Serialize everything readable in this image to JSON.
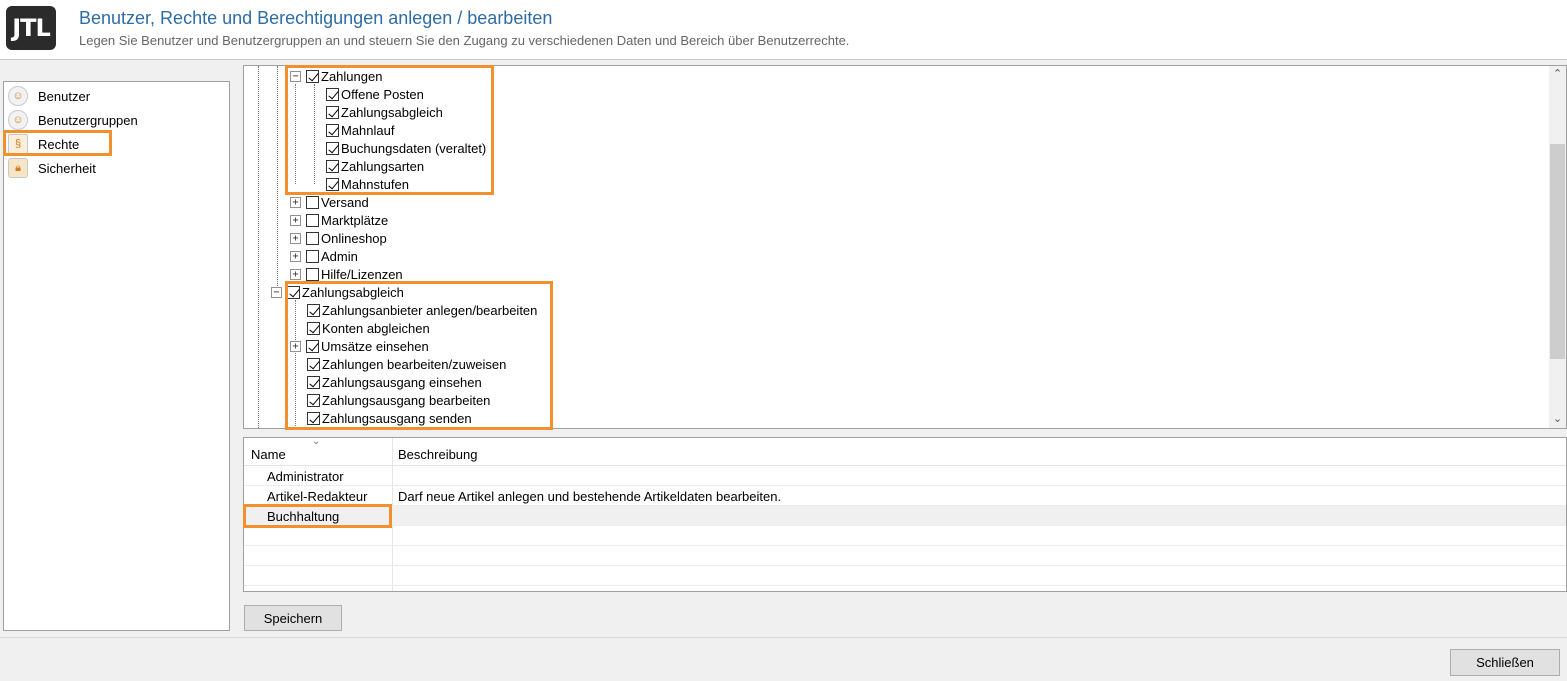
{
  "header": {
    "logo": "JTL",
    "title": "Benutzer, Rechte und Berechtigungen anlegen / bearbeiten",
    "subtitle": "Legen Sie Benutzer und Benutzergruppen an und steuern Sie den Zugang zu verschiedenen Daten und Bereich über Benutzerrechte."
  },
  "nav": {
    "items": [
      {
        "label": "Benutzer",
        "icon": "user-icon"
      },
      {
        "label": "Benutzergruppen",
        "icon": "user-group-icon"
      },
      {
        "label": "Rechte",
        "icon": "rights-icon",
        "highlighted": true
      },
      {
        "label": "Sicherheit",
        "icon": "lock-icon"
      }
    ]
  },
  "tree": {
    "nodes": [
      {
        "label": "Zahlungen",
        "checked": true,
        "expander": "minus"
      },
      {
        "label": "Offene Posten",
        "checked": true
      },
      {
        "label": "Zahlungsabgleich",
        "checked": true
      },
      {
        "label": "Mahnlauf",
        "checked": true
      },
      {
        "label": "Buchungsdaten (veraltet)",
        "checked": true
      },
      {
        "label": "Zahlungsarten",
        "checked": true
      },
      {
        "label": "Mahnstufen",
        "checked": true
      },
      {
        "label": "Versand",
        "checked": false,
        "expander": "plus"
      },
      {
        "label": "Marktplätze",
        "checked": false,
        "expander": "plus"
      },
      {
        "label": "Onlineshop",
        "checked": false,
        "expander": "plus"
      },
      {
        "label": "Admin",
        "checked": false,
        "expander": "plus"
      },
      {
        "label": "Hilfe/Lizenzen",
        "checked": false,
        "expander": "plus"
      },
      {
        "label": "Zahlungsabgleich",
        "checked": true,
        "expander": "minus"
      },
      {
        "label": "Zahlungsanbieter anlegen/bearbeiten",
        "checked": true
      },
      {
        "label": "Konten abgleichen",
        "checked": true
      },
      {
        "label": "Umsätze einsehen",
        "checked": true,
        "expander": "plus"
      },
      {
        "label": "Zahlungen bearbeiten/zuweisen",
        "checked": true
      },
      {
        "label": "Zahlungsausgang einsehen",
        "checked": true
      },
      {
        "label": "Zahlungsausgang bearbeiten",
        "checked": true
      },
      {
        "label": "Zahlungsausgang senden",
        "checked": true
      }
    ],
    "scroll_up": "⌃",
    "scroll_down": "⌄"
  },
  "grid": {
    "col_name": "Name",
    "col_desc": "Beschreibung",
    "sort_glyph": "⌄",
    "rows": [
      {
        "name": "Administrator",
        "desc": ""
      },
      {
        "name": "Artikel-Redakteur",
        "desc": "Darf neue Artikel anlegen und bestehende Artikeldaten bearbeiten."
      },
      {
        "name": "Buchhaltung",
        "desc": "",
        "selected": true
      }
    ]
  },
  "buttons": {
    "save": "Speichern",
    "close": "Schließen"
  },
  "colors": {
    "highlight": "#f0912d",
    "title": "#2e6da4"
  }
}
